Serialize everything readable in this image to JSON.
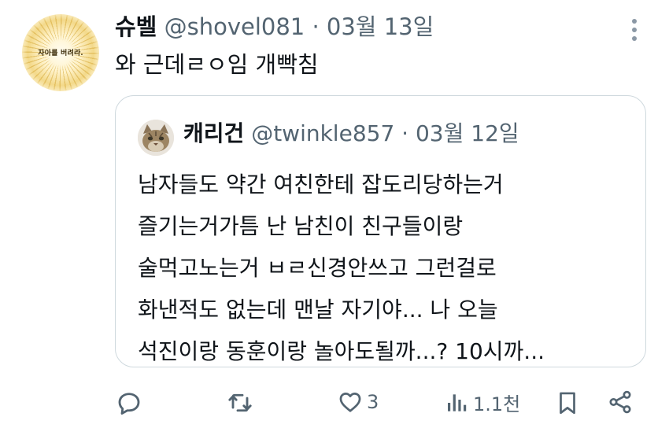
{
  "post": {
    "display_name": "슈벨",
    "handle": "@shovel081",
    "separator": "·",
    "date": "03월 13일",
    "text": "와 근데ㄹㅇ임 개빡침",
    "avatar_text": "자아를 버려라."
  },
  "quoted_post": {
    "display_name": "캐리건",
    "handle": "@twinkle857",
    "separator": "·",
    "date": "03월 12일",
    "lines": [
      "남자들도 약간 여친한테 잡도리당하는거",
      "즐기는거가틈 난 남친이 친구들이랑",
      "술먹고노는거 ㅂㄹ신경안쓰고 그런걸로",
      "화낸적도 없는데 맨날 자기야... 나 오늘",
      "석진이랑 동훈이랑 놀아도될까...? 10시까..."
    ]
  },
  "actions": {
    "reply_icon": "reply-icon",
    "retweet_icon": "retweet-icon",
    "like_icon": "heart-icon",
    "like_count": "3",
    "views_icon": "views-icon",
    "views_count": "1.1천",
    "bookmark_icon": "bookmark-icon",
    "share_icon": "share-icon"
  },
  "colors": {
    "text": "#0f1419",
    "secondary": "#536471",
    "border": "#cfd9de"
  }
}
